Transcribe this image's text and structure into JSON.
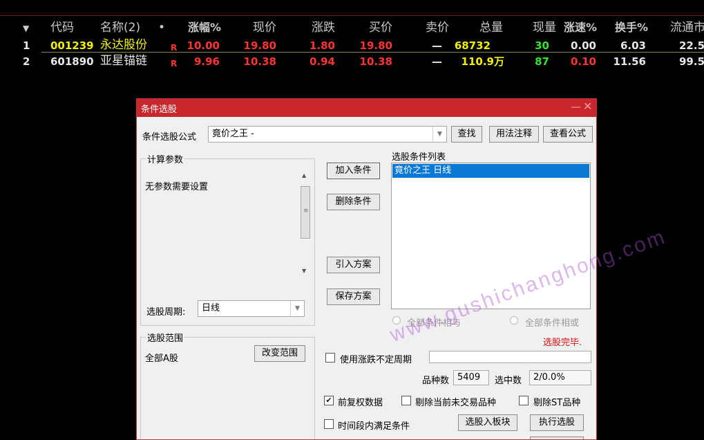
{
  "columns": [
    {
      "label": "▼",
      "key": "sort"
    },
    {
      "label": "代码",
      "key": "code"
    },
    {
      "label": "名称(2)",
      "key": "name"
    },
    {
      "label": "•",
      "key": "dot"
    },
    {
      "label": "涨幅%",
      "key": "pct"
    },
    {
      "label": "现价",
      "key": "price"
    },
    {
      "label": "涨跌",
      "key": "chg"
    },
    {
      "label": "买价",
      "key": "bid"
    },
    {
      "label": "卖价",
      "key": "ask"
    },
    {
      "label": "总量",
      "key": "vol"
    },
    {
      "label": "现量",
      "key": "cur"
    },
    {
      "label": "涨速%",
      "key": "speed"
    },
    {
      "label": "换手%",
      "key": "turn"
    },
    {
      "label": "流通市",
      "key": "mcap"
    }
  ],
  "rows": [
    {
      "idx": "1",
      "code": "001239",
      "name": "永达股份",
      "flag": "R",
      "pct": "10.00",
      "price": "19.80",
      "chg": "1.80",
      "bid": "19.80",
      "ask": "—",
      "vol": "68732",
      "cur": "30",
      "speed": "0.00",
      "turn": "6.03",
      "mcap": "22.5"
    },
    {
      "idx": "2",
      "code": "601890",
      "name": "亚星锚链",
      "flag": "R",
      "pct": "9.96",
      "price": "10.38",
      "chg": "0.94",
      "bid": "10.38",
      "ask": "—",
      "vol": "110.9万",
      "cur": "87",
      "speed": "0.10",
      "turn": "11.56",
      "mcap": "99.5"
    }
  ],
  "dialog": {
    "title": "条件选股",
    "min_icon": "minimize-icon",
    "close_icon": "close-icon",
    "formula_label": "条件选股公式",
    "formula_value": "竟价之王  -",
    "find_btn": "查找",
    "usage_btn": "用法注释",
    "view_btn": "查看公式",
    "params_group": "计算参数",
    "params_text": "无参数需要设置",
    "period_label": "选股周期:",
    "period_value": "日线",
    "add_btn": "加入条件",
    "delete_btn": "删除条件",
    "import_btn": "引入方案",
    "save_btn": "保存方案",
    "cond_list_title": "选股条件列表",
    "cond_items": [
      "竟价之王  日线"
    ],
    "radio_and": "全部条件相与",
    "radio_or": "全部条件相或",
    "status": "选股完毕.",
    "range_group": "选股范围",
    "range_value": "全部A股",
    "change_range_btn": "改变范围",
    "use_uncertain": "使用涨跌不定周期",
    "count_label": "品种数",
    "count_value": "5409",
    "selected_label": "选中数",
    "selected_value": "2/0.0%",
    "chk_prev": "前复权数据",
    "chk_exclude": "剔除当前未交易品种",
    "chk_st": "剔除ST品种",
    "chk_time": "时间段内满足条件",
    "to_block_btn": "选股入板块",
    "exec_btn": "执行选股"
  },
  "watermark": "www.gushichanghong.com",
  "colors": {
    "bg": "#000000",
    "titlebar": "#c8282d",
    "select": "#0a78d7",
    "up": "#ff3232",
    "code": "#f2f200",
    "vol_green": "#32e632"
  }
}
